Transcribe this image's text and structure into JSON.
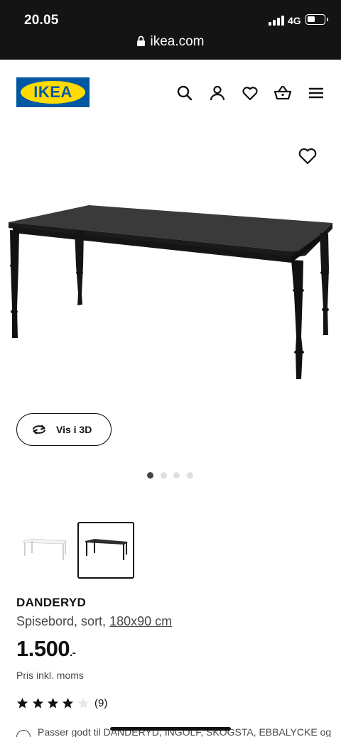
{
  "status_bar": {
    "time": "20.05",
    "network": "4G",
    "url": "ikea.com"
  },
  "header": {
    "logo_text": "IKEA",
    "icons": [
      "search-icon",
      "user-icon",
      "heart-icon",
      "basket-icon",
      "menu-icon"
    ]
  },
  "media": {
    "view_3d_label": "Vis i 3D",
    "carousel_total": 4,
    "carousel_active": 1
  },
  "variants": [
    {
      "color": "white",
      "selected": false
    },
    {
      "color": "black",
      "selected": true
    }
  ],
  "product": {
    "name": "DANDERYD",
    "description_prefix": "Spisebord, sort,",
    "size": "180x90 cm",
    "price": "1.500",
    "price_suffix": ".-",
    "price_note": "Pris inkl. moms",
    "rating": 4,
    "rating_max": 5,
    "review_count": "(9)",
    "compat_text": "Passer godt til DANDERYD, INGOLF, SKOGSTA, EBBALYCKE og"
  },
  "colors": {
    "ikea_blue": "#0058a3",
    "ikea_yellow": "#ffdb00",
    "status_bar_bg": "#141414"
  }
}
